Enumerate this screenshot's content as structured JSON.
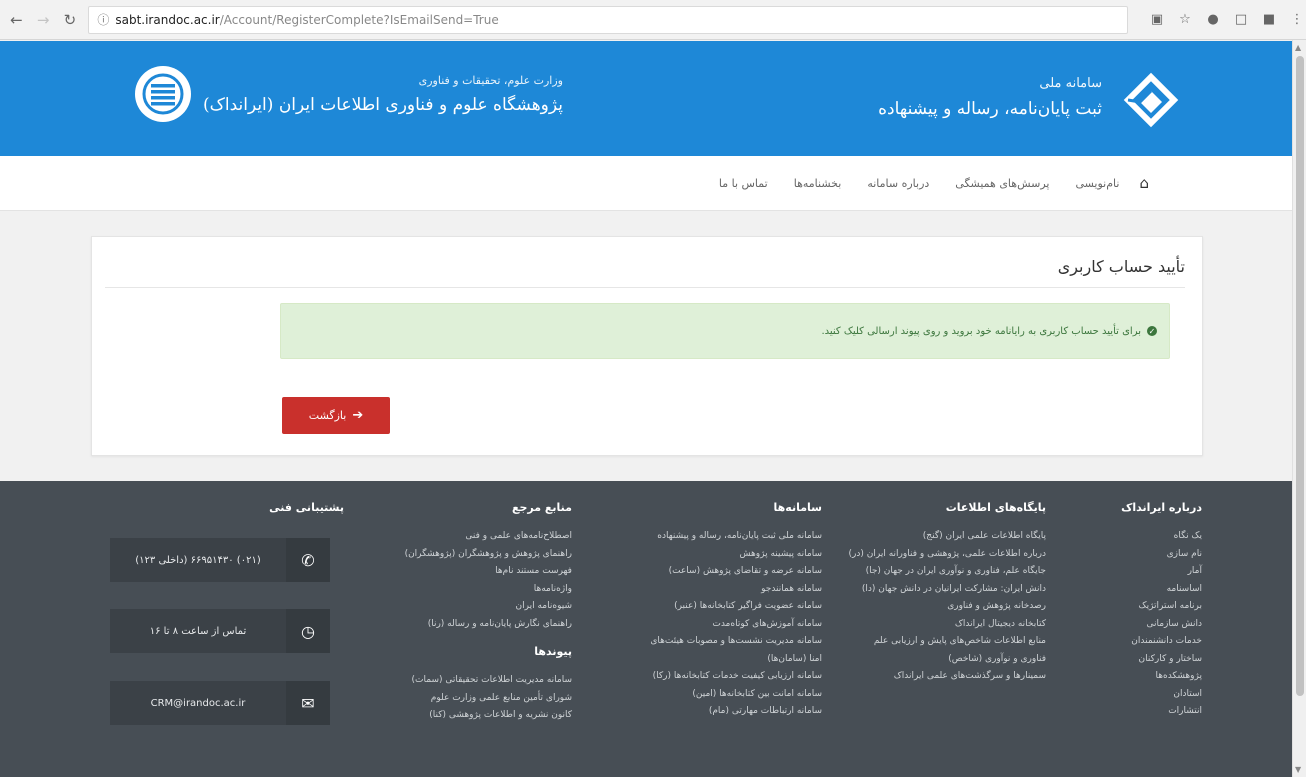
{
  "browser": {
    "url_host": "sabt.irandoc.ac.ir",
    "url_path": "/Account/RegisterComplete?IsEmailSend=True"
  },
  "header": {
    "sabt_small": "سامانه ملی",
    "sabt_main": "ثبت پایان‌نامه، رساله و پیشنهاده",
    "irandoc_small": "وزارت علوم، تحقیقات و فناوری",
    "irandoc_main": "پژوهشگاه علوم و فناوری اطلاعات ایران (ایرانداک)"
  },
  "nav": {
    "items": [
      "نام‌نویسی",
      "پرسش‌های همیشگی",
      "درباره سامانه",
      "بخشنامه‌ها",
      "تماس با ما"
    ]
  },
  "main": {
    "title": "تأیید حساب کاربری",
    "alert": "برای تأیید حساب کاربری به رایانامه خود بروید و روی پیوند ارسالی کلیک کنید.",
    "back_button": "بازگشت"
  },
  "footer": {
    "about": {
      "title": "درباره ایرانداک",
      "items": [
        "یک نگاه",
        "نام سازی",
        "آمار",
        "اساسنامه",
        "برنامه استراتژیک",
        "دانش سازمانی",
        "خدمات دانشنمندان",
        "ساختار و کارکنان",
        "پژوهشکده‌ها",
        "استادان",
        "انتشارات"
      ]
    },
    "databases": {
      "title": "پایگاه‌های اطلاعات",
      "items": [
        "پایگاه اطلاعات علمی ایران (گنج)",
        "درباره اطلاعات علمی، پژوهشی و فناورانه ایران (در)",
        "جایگاه علم، فناوری و نوآوری ایران در جهان (جا)",
        "دانش ایران: مشارکت ایرانیان در دانش جهان (دا)",
        "رصدخانه پژوهش و فناوری",
        "کتابخانه دیجیتال ایرانداک",
        "منابع اطلاعات شاخص‌های پایش و ارزیابی علم",
        "فناوری و نوآوری (شاخص)",
        "سمینارها و سرگذشت‌های علمی ایرانداک"
      ]
    },
    "systems": {
      "title": "سامانه‌ها",
      "items": [
        "سامانه ملی ثبت پایان‌نامه، رساله و پیشنهاده",
        "سامانه پیشینه پژوهش",
        "سامانه عرضه و تقاضای پژوهش (ساعت)",
        "سامانه همانندجو",
        "سامانه عضویت فراگیر کتابخانه‌ها (عنبر)",
        "سامانه آموزش‌های کوتاه‌مدت",
        "سامانه مدیریت نشست‌ها و مصوبات هیئت‌های",
        "امنا (سامان‌ها)",
        "سامانه ارزیابی کیفیت خدمات کتابخانه‌ها (رکا)",
        "سامانه امانت بین کتابخانه‌ها (امین)",
        "سامانه ارتباطات مهارتی (مام)"
      ]
    },
    "refs": {
      "title": "منابع مرجع",
      "items": [
        "اصطلاح‌نامه‌های علمی و فنی",
        "راهنمای پژوهش و پژوهشگران (پژوهشگران)",
        "فهرست مستند نام‌ها",
        "واژه‌نامه‌ها",
        "شیوه‌نامه ایران",
        "راهنمای نگارش پایان‌نامه و رساله (رنا)"
      ],
      "links_title": "پیوندها",
      "links": [
        "سامانه مدیریت اطلاعات تحقیقاتی (سمات)",
        "شورای تأمین منابع علمی وزارت علوم",
        "کانون نشریه و اطلاعات پژوهشی (کنا)"
      ]
    },
    "support": {
      "title": "پشتیبانی فنی",
      "phone": "(داخلی ۱۲۳) ۰۲۱) ۶۶۹۵۱۴۳۰)",
      "hours": "تماس از ساعت ۸ تا ۱۶",
      "email": "CRM@irandoc.ac.ir"
    }
  },
  "colors": {
    "header_blue": "#1e88d7",
    "footer_bg": "#474e55",
    "alert_bg": "#dff0d8",
    "button_red": "#c9302c"
  }
}
